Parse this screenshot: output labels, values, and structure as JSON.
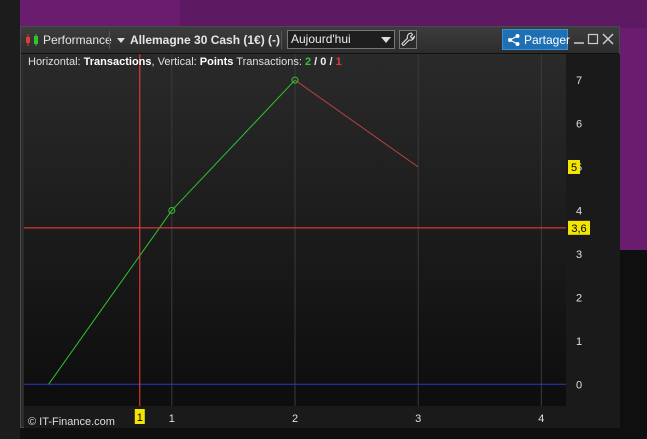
{
  "toolbar": {
    "title": "Performance",
    "instrument": "Allemagne 30 Cash (1€) (-)",
    "period": "Aujourd'hui",
    "share_label": "Partager"
  },
  "info": {
    "horizontal_prefix": "Horizontal: ",
    "horizontal": "Transactions",
    "vertical_prefix": ", Vertical: ",
    "vertical": "Points",
    "transactions_prefix": "  Transactions: ",
    "wins": "2",
    "sep1": " / ",
    "neutral": "0",
    "sep2": " / ",
    "losses": "1"
  },
  "watermark": "© IT-Finance.com",
  "cursor": {
    "x_value": "1",
    "y_value": "3,6"
  },
  "last_value_label": "5",
  "colors": {
    "win": "#2fc430",
    "loss": "#e03a3a",
    "accent": "#1e6fb3",
    "cursor": "#ff3b3b",
    "zero_line": "#2a36c9"
  },
  "chart_data": {
    "type": "line",
    "x": [
      0,
      1,
      2,
      3
    ],
    "y": [
      0,
      4,
      7,
      5
    ],
    "segment_colors": [
      "#2fc430",
      "#2fc430",
      "#b84040"
    ],
    "xticks": [
      "1",
      "2",
      "3",
      "4"
    ],
    "yticks": [
      "0",
      "1",
      "2",
      "3",
      "4",
      "5",
      "6",
      "7"
    ],
    "xlim": [
      -0.2,
      4.2
    ],
    "ylim": [
      -0.5,
      7.6
    ],
    "cursor_x": 0.74,
    "cursor_y": 3.6
  }
}
